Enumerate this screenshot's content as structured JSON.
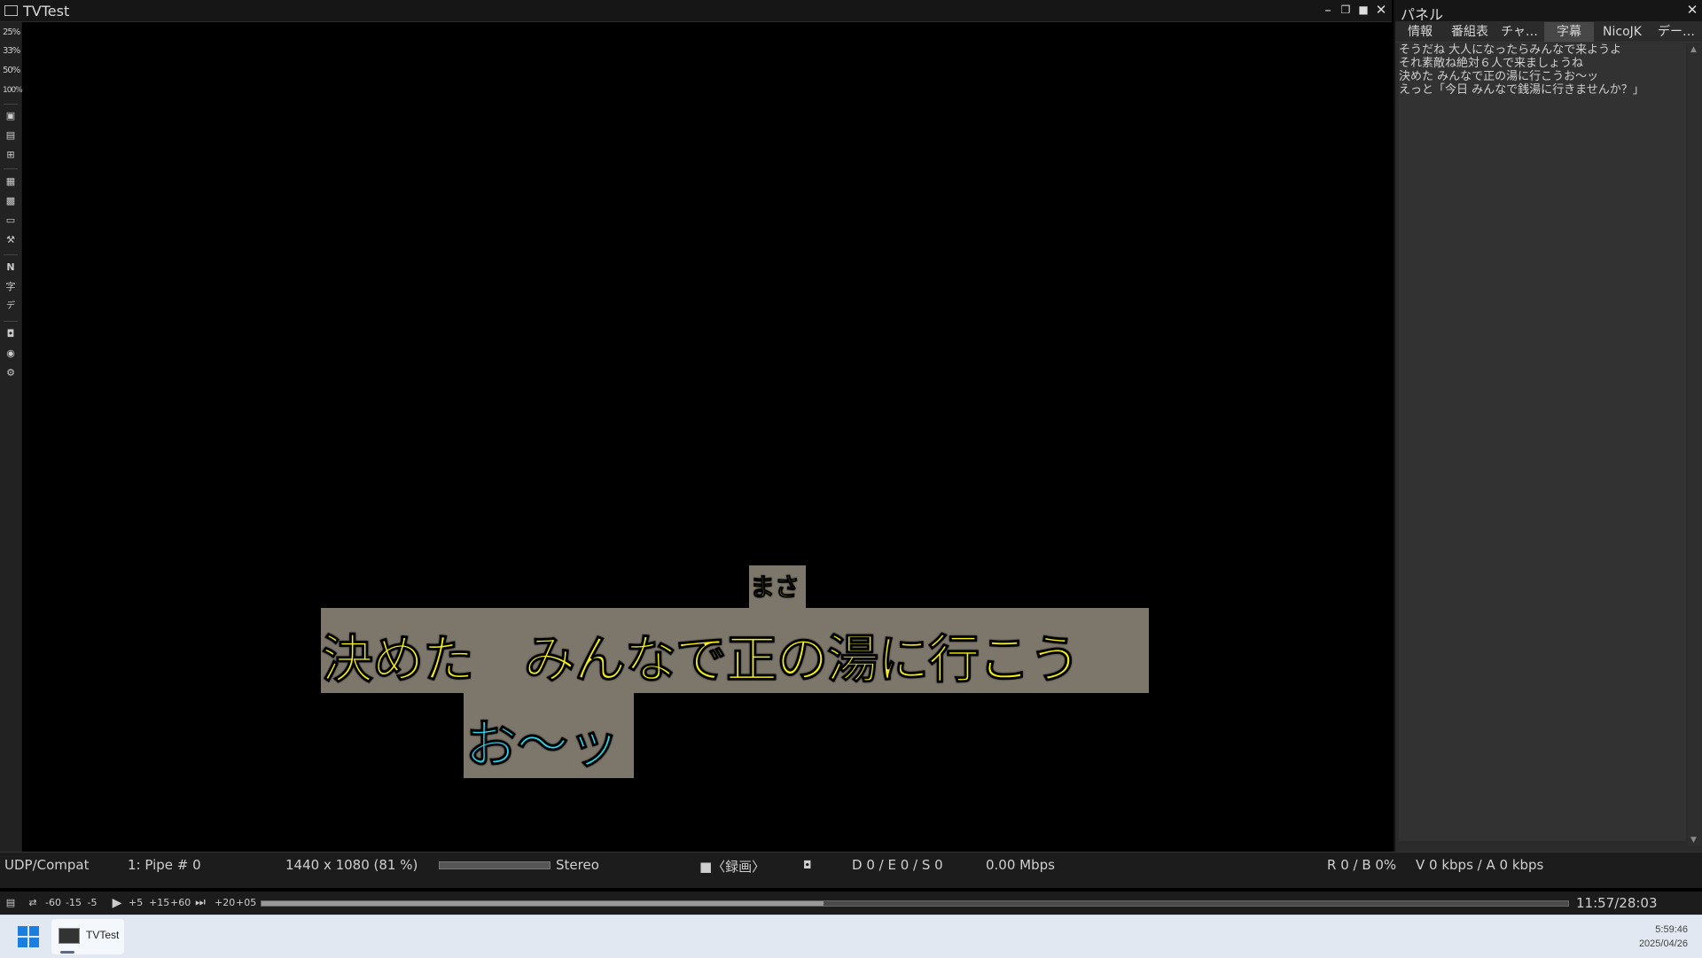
{
  "window": {
    "title": "TVTest"
  },
  "toolbar": {
    "zoom": [
      "25%",
      "33%",
      "50%",
      "100%"
    ]
  },
  "video": {
    "ruby": "まさ",
    "line1": "決めた　みんなで正の湯に行こう",
    "line2": "お～ッ",
    "line1_color": "#f4ef18",
    "line2_color": "#2fd0e8"
  },
  "panel": {
    "title": "パネル",
    "tabs": [
      "情報",
      "番組表",
      "チャ…",
      "字幕",
      "NicoJK",
      "デー…"
    ],
    "active_tab": "字幕",
    "captions": [
      "そうだね 大人になったらみんなで来ようよ",
      "それ素敵ね絶対６人で来ましょうね",
      "決めた みんなで正の湯に行こうお～ッ",
      "えっと「今日 みんなで銭湯に行きませんか？」"
    ]
  },
  "status": {
    "driver": "UDP/Compat",
    "channel": "1: Pipe # 0",
    "resolution": "1440 x 1080 (81 %)",
    "audio": "Stereo",
    "record": "■〈録画〉",
    "errors": "D 0 / E 0 / S 0",
    "bitrate": "0.00 Mbps",
    "rb": "R 0 / B 0%",
    "va": "V 0 kbps / A 0 kbps"
  },
  "seek": {
    "buttons": [
      "-60",
      "-15",
      "-5",
      "▶",
      "+5",
      "+15",
      "+60",
      "⏭",
      "+20",
      "+05"
    ],
    "time": "11:57/28:03",
    "progress": 0.43
  },
  "taskbar": {
    "app_label": "TVTest",
    "time": "5:59:46",
    "date": "2025/04/26"
  }
}
